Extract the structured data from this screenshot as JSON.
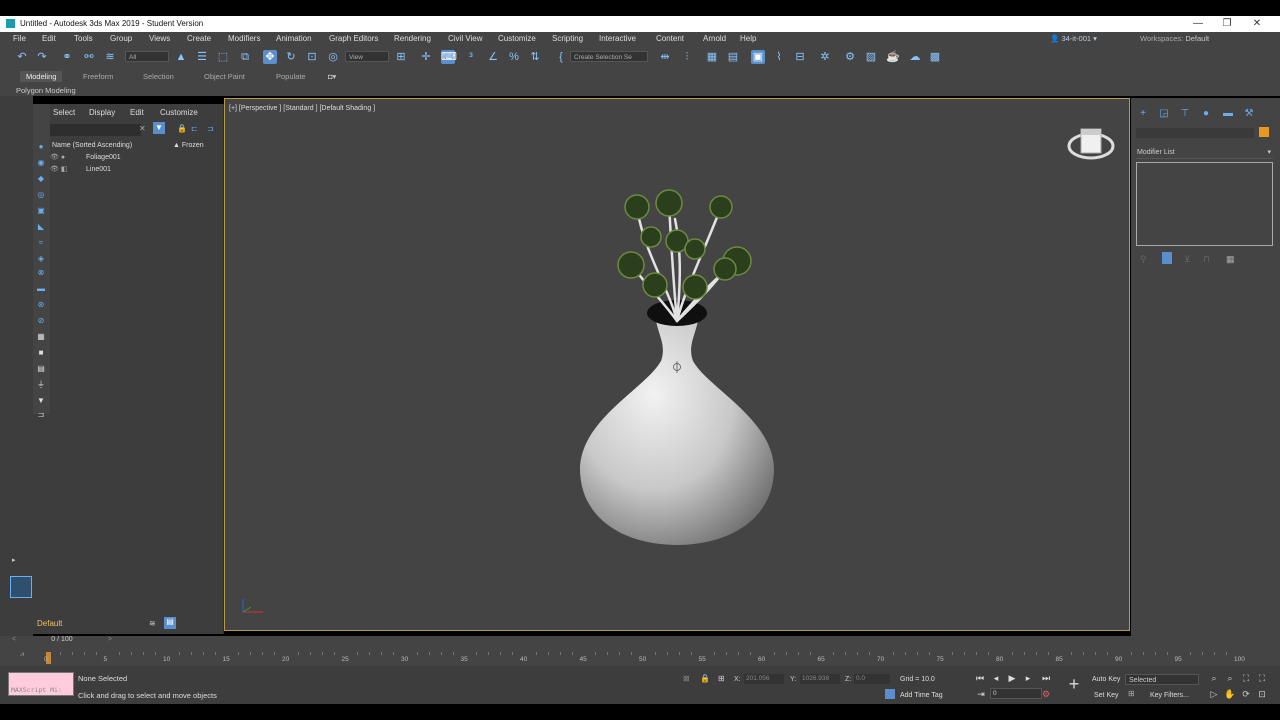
{
  "window": {
    "title": "Untitled - Autodesk 3ds Max 2019 - Student Version",
    "minimize": "—",
    "restore": "❐",
    "close": "✕"
  },
  "menu": {
    "items": [
      "File",
      "Edit",
      "Tools",
      "Group",
      "Views",
      "Create",
      "Modifiers",
      "Animation",
      "Graph Editors",
      "Rendering",
      "Civil View",
      "Customize",
      "Scripting",
      "Interactive",
      "Content",
      "Arnold",
      "Help"
    ],
    "user": "34-it-001",
    "workspaces_label": "Workspaces:",
    "workspace_value": "Default"
  },
  "toolbar": {
    "selection_filter": "All",
    "ref_coord": "View",
    "named_selection": "Create Selection Se"
  },
  "ribbon": {
    "tabs": [
      "Modeling",
      "Freeform",
      "Selection",
      "Object Paint",
      "Populate"
    ],
    "sub_label": "Polygon Modeling"
  },
  "scene_explorer": {
    "tabs": [
      "Select",
      "Display",
      "Edit",
      "Customize"
    ],
    "col_name": "Name (Sorted Ascending)",
    "col_frozen": "▲ Frozen",
    "rows": [
      "Foliage001",
      "Line001"
    ],
    "layer": "Default"
  },
  "viewport": {
    "label": "[+] [Perspective ] [Standard ] [Default Shading ]"
  },
  "command_panel": {
    "modifier_list": "Modifier List"
  },
  "timeline": {
    "slider": "0 / 100",
    "ticks": [
      "0",
      "5",
      "10",
      "15",
      "20",
      "25",
      "30",
      "35",
      "40",
      "45",
      "50",
      "55",
      "60",
      "65",
      "70",
      "75",
      "80",
      "85",
      "90",
      "95",
      "100"
    ]
  },
  "status": {
    "maxscript": "MAXScript Mi:",
    "selection": "None Selected",
    "prompt": "Click and drag to select and move objects",
    "x_label": "X:",
    "x_value": "201.056",
    "y_label": "Y:",
    "y_value": "1026.938",
    "z_label": "Z:",
    "z_value": "0.0",
    "grid": "Grid = 10.0",
    "add_time_tag": "Add Time Tag",
    "auto_key": "Auto Key",
    "set_key": "Set Key",
    "key_mode": "Selected",
    "key_filters": "Key Filters...",
    "frame": "0"
  },
  "colors": {
    "accent": "#5b8fcc",
    "viewport_border": "#b89a4a",
    "layer_text": "#f0c060"
  }
}
